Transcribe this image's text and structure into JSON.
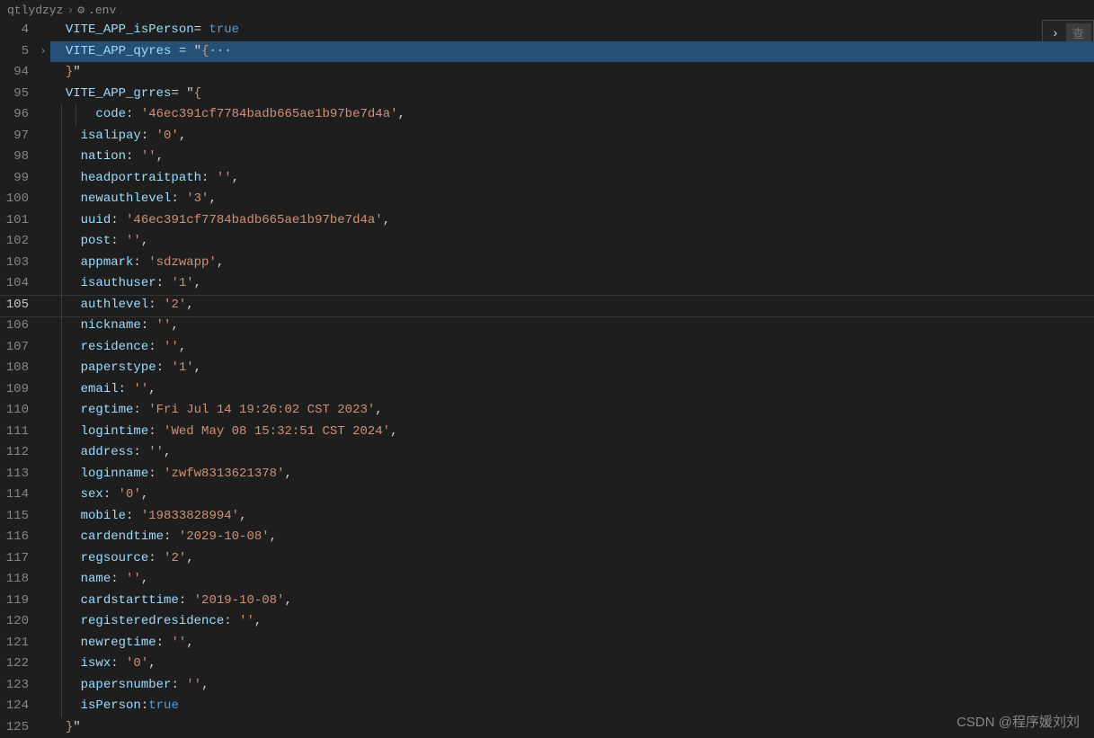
{
  "breadcrumb": {
    "folder": "qtlydzyz",
    "file": ".env"
  },
  "find": {
    "placeholder": "查找"
  },
  "watermark": "CSDN @程序媛刘刘",
  "gutter": [
    "4",
    "5",
    "94",
    "95",
    "96",
    "97",
    "98",
    "99",
    "100",
    "101",
    "102",
    "103",
    "104",
    "105",
    "106",
    "107",
    "108",
    "109",
    "110",
    "111",
    "112",
    "113",
    "114",
    "115",
    "116",
    "117",
    "118",
    "119",
    "120",
    "121",
    "122",
    "123",
    "124",
    "125"
  ],
  "currentLine": "105",
  "highlightedLine": "5",
  "code": {
    "l4": {
      "var": "VITE_APP_isPerson",
      "op": "= ",
      "bool": "true"
    },
    "l5": {
      "var": "VITE_APP_qyres",
      "op": " = ",
      "q1": "\"",
      "brace": "{",
      "ellipsis": "···"
    },
    "l94": {
      "brace": "}",
      "q2": "\""
    },
    "l95": {
      "var": "VITE_APP_grres",
      "op": "= ",
      "q1": "\"",
      "brace": "{"
    },
    "l96": {
      "key": "code",
      "colon": ": ",
      "val": "'46ec391cf7784badb665ae1b97be7d4a'",
      "comma": ","
    },
    "l97": {
      "key": "isalipay",
      "colon": ": ",
      "val": "'0'",
      "comma": ","
    },
    "l98": {
      "key": "nation",
      "colon": ": ",
      "val": "''",
      "comma": ","
    },
    "l99": {
      "key": "headportraitpath",
      "colon": ": ",
      "val": "''",
      "comma": ","
    },
    "l100": {
      "key": "newauthlevel",
      "colon": ": ",
      "val": "'3'",
      "comma": ","
    },
    "l101": {
      "key": "uuid",
      "colon": ": ",
      "val": "'46ec391cf7784badb665ae1b97be7d4a'",
      "comma": ","
    },
    "l102": {
      "key": "post",
      "colon": ": ",
      "val": "''",
      "comma": ","
    },
    "l103": {
      "key": "appmark",
      "colon": ": ",
      "val": "'sdzwapp'",
      "comma": ","
    },
    "l104": {
      "key": "isauthuser",
      "colon": ": ",
      "val": "'1'",
      "comma": ","
    },
    "l105": {
      "key": "authlevel",
      "colon": ": ",
      "val": "'2'",
      "comma": ","
    },
    "l106": {
      "key": "nickname",
      "colon": ": ",
      "val": "''",
      "comma": ","
    },
    "l107": {
      "key": "residence",
      "colon": ": ",
      "val": "''",
      "comma": ","
    },
    "l108": {
      "key": "paperstype",
      "colon": ": ",
      "val": "'1'",
      "comma": ","
    },
    "l109": {
      "key": "email",
      "colon": ": ",
      "val": "''",
      "comma": ","
    },
    "l110": {
      "key": "regtime",
      "colon": ": ",
      "val": "'Fri Jul 14 19:26:02 CST 2023'",
      "comma": ","
    },
    "l111": {
      "key": "logintime",
      "colon": ": ",
      "val": "'Wed May 08 15:32:51 CST 2024'",
      "comma": ","
    },
    "l112": {
      "key": "address",
      "colon": ": ",
      "val": "''",
      "comma": ","
    },
    "l113": {
      "key": "loginname",
      "colon": ": ",
      "val": "'zwfw8313621378'",
      "comma": ","
    },
    "l114": {
      "key": "sex",
      "colon": ": ",
      "val": "'0'",
      "comma": ","
    },
    "l115": {
      "key": "mobile",
      "colon": ": ",
      "val": "'19833828994'",
      "comma": ","
    },
    "l116": {
      "key": "cardendtime",
      "colon": ": ",
      "val": "'2029-10-08'",
      "comma": ","
    },
    "l117": {
      "key": "regsource",
      "colon": ": ",
      "val": "'2'",
      "comma": ","
    },
    "l118": {
      "key": "name",
      "colon": ": ",
      "val": "''",
      "comma": ","
    },
    "l119": {
      "key": "cardstarttime",
      "colon": ": ",
      "val": "'2019-10-08'",
      "comma": ","
    },
    "l120": {
      "key": "registeredresidence",
      "colon": ": ",
      "val": "''",
      "comma": ","
    },
    "l121": {
      "key": "newregtime",
      "colon": ": ",
      "val": "''",
      "comma": ","
    },
    "l122": {
      "key": "iswx",
      "colon": ": ",
      "val": "'0'",
      "comma": ","
    },
    "l123": {
      "key": "papersnumber",
      "colon": ": ",
      "val": "''",
      "comma": ","
    },
    "l124": {
      "key": "isPerson",
      "colon": ":",
      "bool": "true"
    },
    "l125": {
      "brace": "}",
      "q2": "\""
    }
  }
}
